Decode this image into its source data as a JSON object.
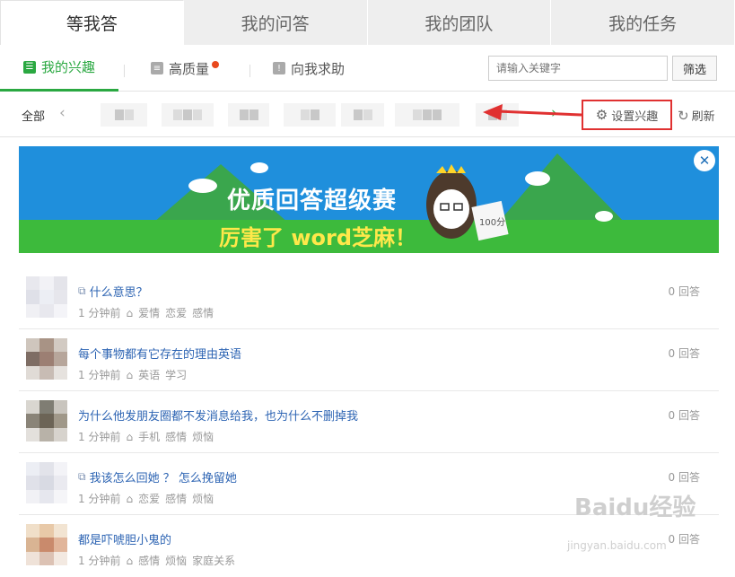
{
  "top_tabs": [
    "等我答",
    "我的问答",
    "我的团队",
    "我的任务"
  ],
  "sub_tabs": {
    "interests": "我的兴趣",
    "quality": "高质量",
    "help": "向我求助"
  },
  "search": {
    "placeholder": "请输入关键字",
    "button": "筛选"
  },
  "interest_bar": {
    "all_label": "全部",
    "settings_label": "设置兴趣",
    "refresh_label": "刷新"
  },
  "banner": {
    "title": "优质回答超级赛",
    "subtitle": "厉害了 word芝麻！",
    "badge": "100分"
  },
  "questions": [
    {
      "title": "什么意思？",
      "has_image": true,
      "time": "1 分钟前",
      "tags": [
        "爱情",
        "恋爱",
        "感情"
      ],
      "count": "0 回答"
    },
    {
      "title": "每个事物都有它存在的理由英语",
      "has_image": false,
      "time": "1 分钟前",
      "tags": [
        "英语",
        "学习"
      ],
      "count": "0 回答"
    },
    {
      "title": "为什么他发朋友圈都不发消息给我，也为什么不删掉我",
      "has_image": false,
      "time": "1 分钟前",
      "tags": [
        "手机",
        "感情",
        "烦恼"
      ],
      "count": "0 回答"
    },
    {
      "title": "我该怎么回她 ？ 怎么挽留她",
      "has_image": true,
      "time": "1 分钟前",
      "tags": [
        "恋爱",
        "感情",
        "烦恼"
      ],
      "count": "0 回答"
    },
    {
      "title": "都是吓唬胆小鬼的",
      "has_image": false,
      "time": "1 分钟前",
      "tags": [
        "感情",
        "烦恼",
        "家庭关系"
      ],
      "count": "0 回答"
    }
  ],
  "watermark": {
    "logo": "Baidu经验",
    "url": "jingyan.baidu.com"
  },
  "colors": {
    "accent": "#2aa841",
    "link": "#2d64b3",
    "highlight": "#e03131"
  }
}
